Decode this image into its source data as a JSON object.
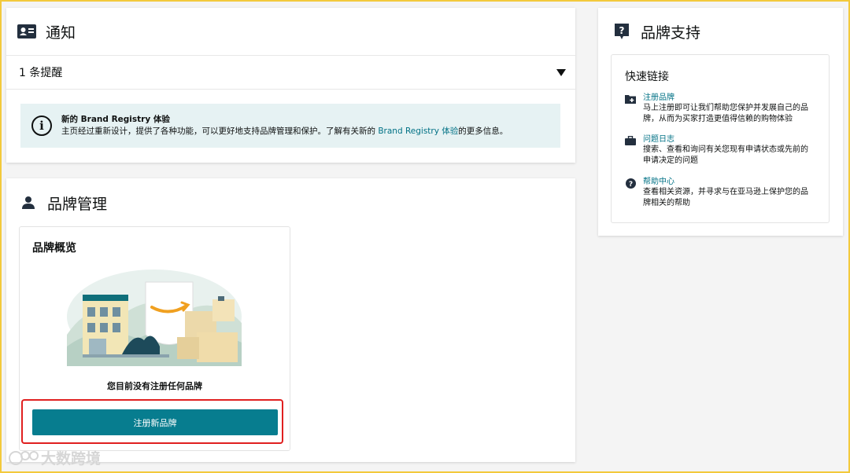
{
  "notice": {
    "title": "通知",
    "icon": "id-card-icon",
    "reminder": "1 条提醒",
    "info_title": "新的 Brand Registry 体验",
    "info_body_pre": "主页经过重新设计，提供了各种功能，可以更好地支持品牌管理和保护。了解有关新的 ",
    "info_link": "Brand Registry 体验",
    "info_body_post": "的更多信息。"
  },
  "brand_management": {
    "title": "品牌管理",
    "icon": "person-icon",
    "overview_title": "品牌概览",
    "empty_message": "您目前没有注册任何品牌",
    "register_button": "注册新品牌"
  },
  "brand_support": {
    "title": "品牌支持",
    "icon": "question-square-icon",
    "quick_links_title": "快速链接",
    "links": [
      {
        "label": "注册品牌",
        "desc": "马上注册即可让我们帮助您保护并发展自己的品牌，从而为买家打造更值得信赖的购物体验",
        "icon": "folder-plus-icon"
      },
      {
        "label": "问题日志",
        "desc": "搜索、查看和询问有关您现有申请状态或先前的申请决定的问题",
        "icon": "briefcase-icon"
      },
      {
        "label": "帮助中心",
        "desc": "查看相关资源，并寻求与在亚马逊上保护您的品牌相关的帮助",
        "icon": "help-circle-icon"
      }
    ]
  },
  "watermark": {
    "text": "大数跨境"
  },
  "colors": {
    "accent": "#077d8f",
    "link": "#007185",
    "info_bg": "#e6f2f3",
    "highlight": "#e02020",
    "frame": "#f3c93c"
  }
}
